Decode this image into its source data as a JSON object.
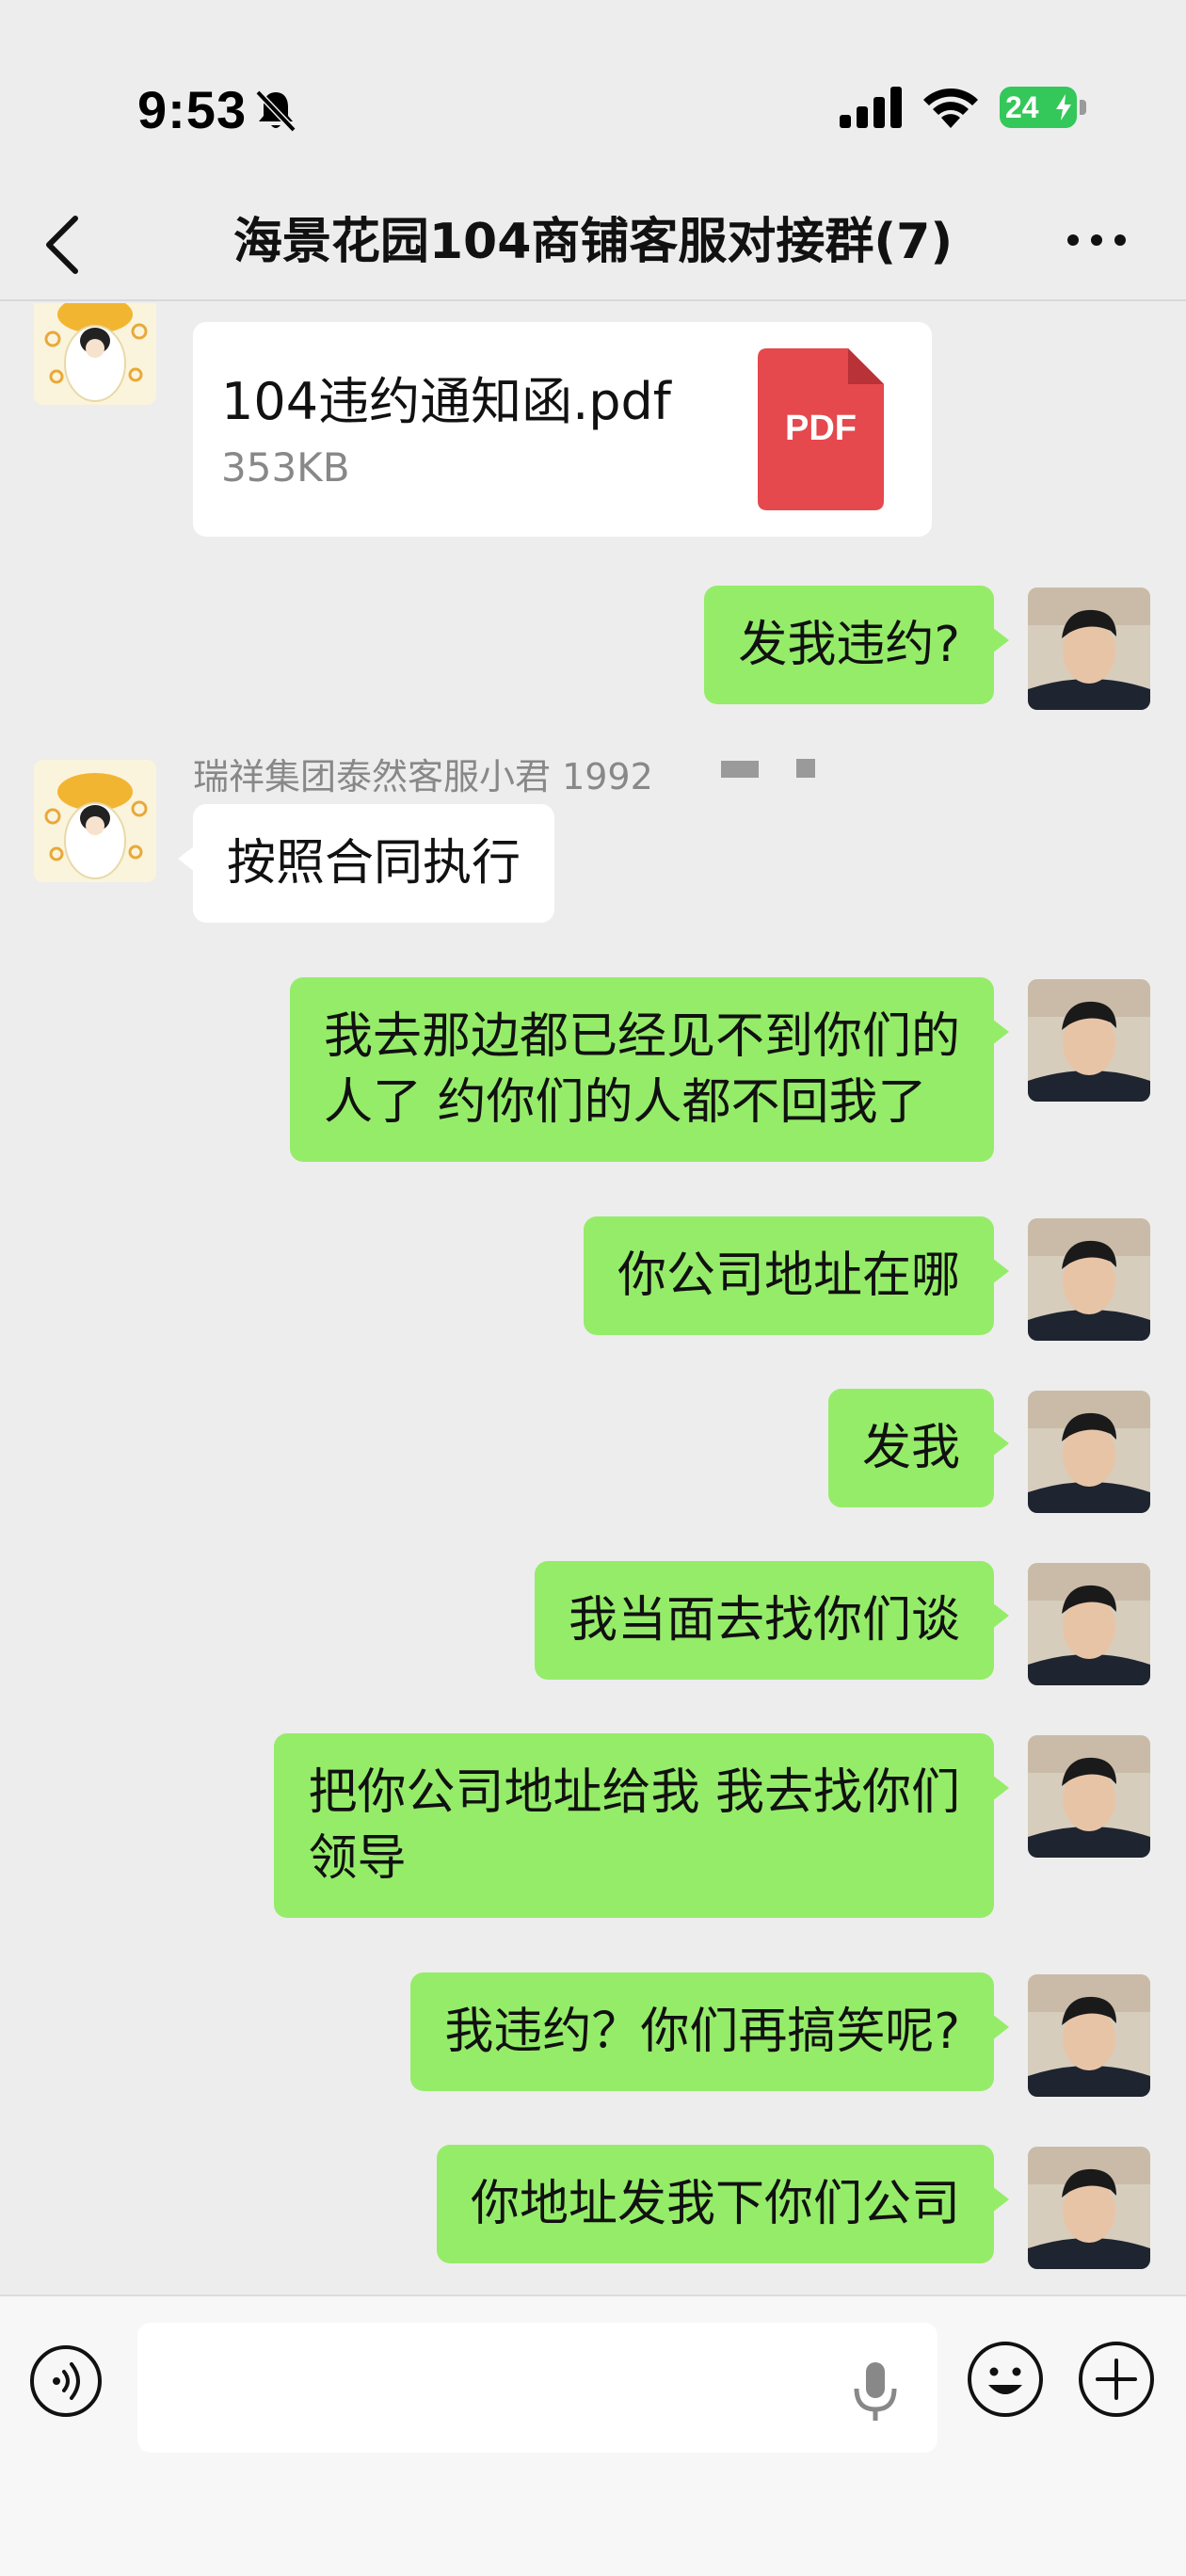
{
  "status_bar": {
    "time": "9:53",
    "battery_level": "24",
    "icons": [
      "bell-muted-icon",
      "signal-icon",
      "wifi-icon",
      "battery-icon",
      "charging-bolt-icon"
    ]
  },
  "nav": {
    "title": "海景花园104商铺客服对接群(7)",
    "back_icon": "chevron-left-icon",
    "more_icon": "more-dots-icon"
  },
  "messages": [
    {
      "type": "file",
      "from": "other",
      "file_name": "104违约通知函.pdf",
      "file_size": "353KB",
      "file_type_label": "PDF"
    },
    {
      "type": "text",
      "from": "me",
      "text": "发我违约?"
    },
    {
      "type": "text",
      "from": "other",
      "sender": "瑞祥集团泰然客服小君 1992",
      "text": "按照合同执行"
    },
    {
      "type": "text",
      "from": "me",
      "lines": [
        "我去那边都已经见不到你们的",
        "人了 约你们的人都不回我了"
      ]
    },
    {
      "type": "text",
      "from": "me",
      "text": "你公司地址在哪"
    },
    {
      "type": "text",
      "from": "me",
      "text": "发我"
    },
    {
      "type": "text",
      "from": "me",
      "text": "我当面去找你们谈"
    },
    {
      "type": "text",
      "from": "me",
      "lines": [
        "把你公司地址给我 我去找你们",
        "领导"
      ]
    },
    {
      "type": "text",
      "from": "me",
      "text": "我违约？你们再搞笑呢?"
    },
    {
      "type": "text",
      "from": "me",
      "text": "你地址发我下你们公司"
    }
  ],
  "input_bar": {
    "placeholder": "",
    "icons": [
      "voice-icon",
      "microphone-icon",
      "emoji-icon",
      "plus-icon"
    ]
  },
  "colors": {
    "background": "#ededed",
    "my_bubble": "#95ec69",
    "other_bubble": "#ffffff",
    "pdf_red": "#e5484d",
    "battery_green": "#34c759"
  }
}
